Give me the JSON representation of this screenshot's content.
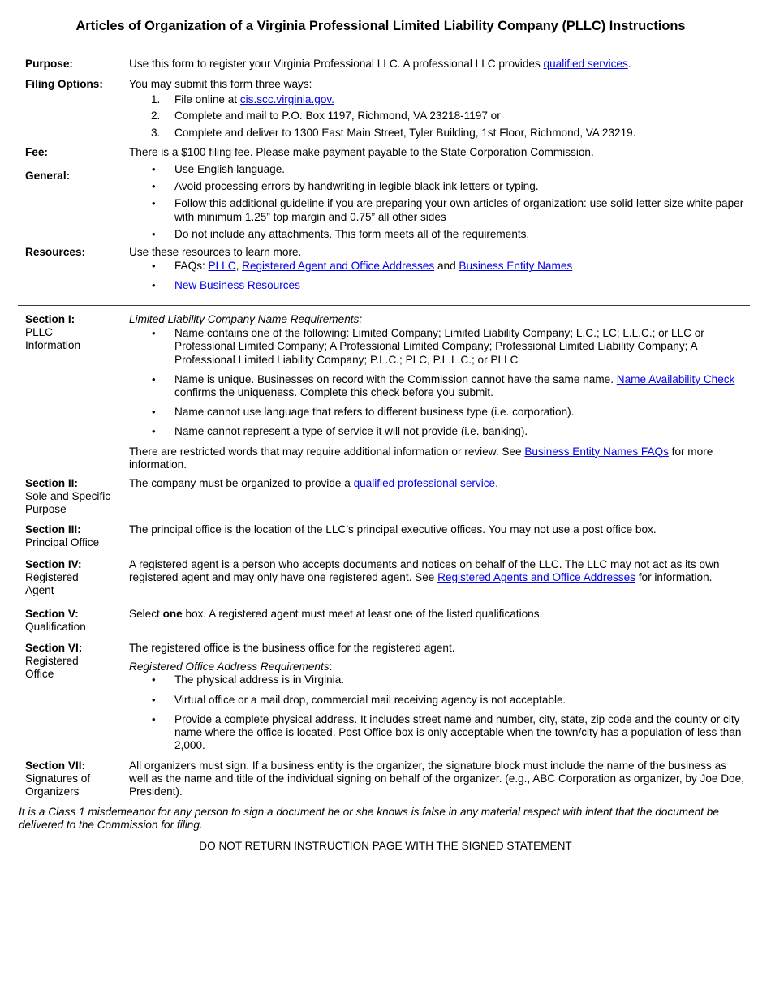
{
  "title": "Articles of Organization of a Virginia Professional Limited Liability Company (PLLC) Instructions",
  "link_color": "#0000ee",
  "purpose": {
    "label": "Purpose:",
    "text_before": "Use this form to register your Virginia Professional LLC. A professional LLC provides ",
    "link": "qualified services",
    "text_after": "."
  },
  "filing_options": {
    "label": "Filing Options:",
    "intro": "You may submit this form three ways:",
    "items": [
      {
        "num": "1.",
        "text_before": "File online at ",
        "link": "cis.scc.virginia.gov."
      },
      {
        "num": "2.",
        "text": "Complete and mail to P.O. Box 1197, Richmond, VA 23218-1197 or"
      },
      {
        "num": "3.",
        "text": "Complete and deliver to 1300 East Main Street, Tyler Building, 1st Floor, Richmond, VA 23219."
      }
    ]
  },
  "fee": {
    "label": "Fee:",
    "text": "There is a $100 filing fee. Please make payment payable to the State Corporation Commission."
  },
  "general": {
    "label": "General:",
    "bullet": "•",
    "items": [
      "Use English language.",
      "Avoid processing errors by handwriting in legible black ink letters or typing.",
      "Follow this additional guideline if you are preparing your own articles of organization: use solid letter size white paper with minimum 1.25” top margin and 0.75” all other sides",
      "Do not include any attachments. This form meets all of the requirements."
    ]
  },
  "resources": {
    "label": "Resources:",
    "intro": "Use these resources to learn more.",
    "faq_prefix": "FAQs: ",
    "faq_link_1": "PLLC",
    "faq_sep_1": ", ",
    "faq_link_2": "Registered Agent and Office Addresses",
    "faq_sep_2": " and ",
    "faq_link_3": "Business Entity Names",
    "link_new_business": "New Business Resources"
  },
  "section1": {
    "label_bold": "Section I:",
    "label_rest": "PLLC Information",
    "heading": "Limited Liability Company Name Requirements:",
    "item1": "Name contains one of the following: Limited Company; Limited Liability Company; L.C.; LC; L.L.C.; or LLC or Professional Limited Company; A Professional Limited Company; Professional Limited Liability Company; A Professional Limited Liability Company; P.L.C.; PLC, P.L.L.C.; or PLLC",
    "item2_before": "Name is unique. Businesses on record with the Commission cannot have the same name. ",
    "item2_link": "Name Availability Check",
    "item2_after": " confirms the uniqueness. Complete this check before you submit.",
    "item3": "Name cannot use language that refers to different business type (i.e. corporation).",
    "item4": "Name cannot represent a type of service it will not provide (i.e. banking).",
    "restricted_before": "There are restricted words that may require additional information or review. See ",
    "restricted_link": "Business Entity Names FAQs",
    "restricted_after": " for more information."
  },
  "section2": {
    "label_bold": "Section II:",
    "label_rest": "Sole and Specific Purpose",
    "text_before": "The company must be organized to provide a ",
    "link": "qualified professional service."
  },
  "section3": {
    "label_bold": "Section III:",
    "label_rest": "Principal Office",
    "text": "The principal office is the location of the LLC’s principal executive offices. You may not use a post office box."
  },
  "section4": {
    "label_bold": "Section IV:",
    "label_rest": "Registered Agent",
    "text_before": "A registered agent is a person who accepts documents and notices on behalf of the LLC. The LLC may not act as its own registered agent and may only have one registered agent. See ",
    "link": "Registered Agents and Office Addresses",
    "text_after": " for information."
  },
  "section5": {
    "label_bold": "Section V:",
    "label_rest": "Qualification",
    "text_before": "Select ",
    "text_bold": "one",
    "text_after": " box. A registered agent must meet at least one of the listed qualifications."
  },
  "section6": {
    "label_bold": "Section VI:",
    "label_rest": "Registered Office",
    "intro": "The registered office is the business office for the registered agent.",
    "heading": "Registered Office Address Requirements",
    "heading_colon": ":",
    "items": [
      "The physical address is in Virginia.",
      "Virtual office or a mail drop, commercial mail receiving agency is not acceptable.",
      "Provide a complete physical address. It includes street name and number, city, state, zip code and the county or city name where the office is located. Post Office box is only acceptable when the town/city has a population of less than 2,000."
    ]
  },
  "section7": {
    "label_bold": "Section VII:",
    "label_rest": "Signatures of Organizers",
    "text": "All organizers must sign. If a business entity is the organizer, the signature block must include the name of the business as well as the name and title of the individual signing on behalf of the organizer. (e.g., ABC Corporation as organizer, by Joe Doe, President)."
  },
  "warning": "It is a Class 1 misdemeanor for any person to sign a document he or she knows is false in any material respect with intent that the document be delivered to the Commission for filing.",
  "footer": "DO NOT RETURN INSTRUCTION PAGE WITH THE SIGNED STATEMENT"
}
